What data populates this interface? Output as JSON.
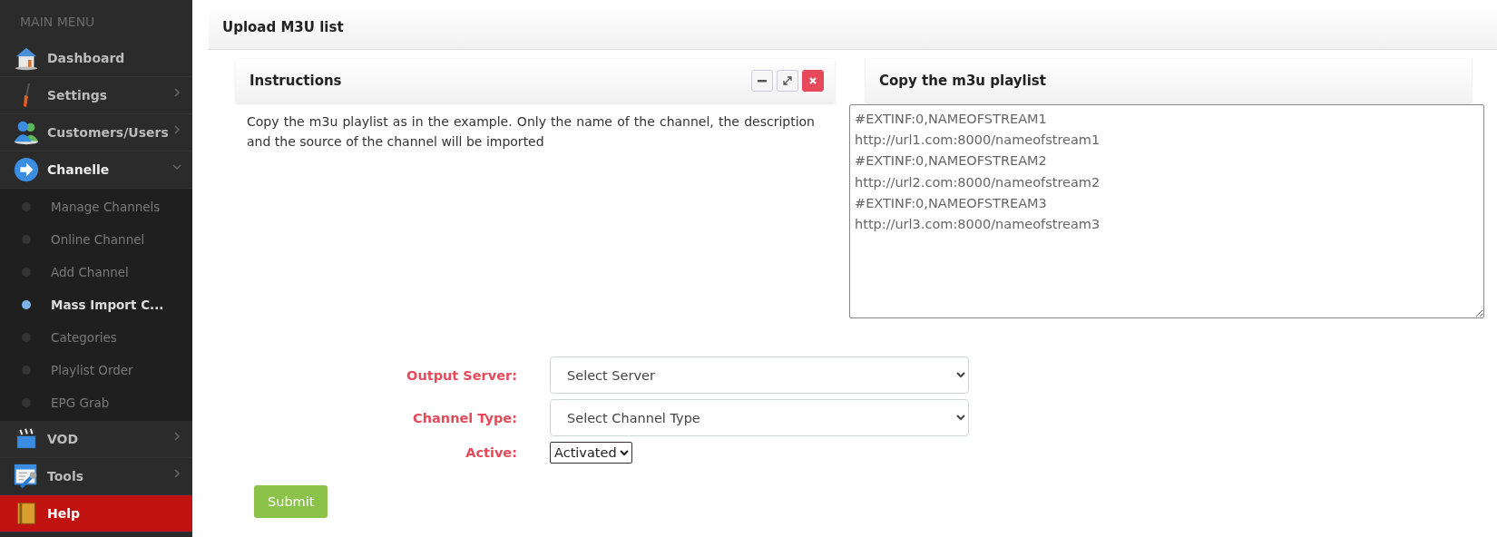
{
  "sidebar": {
    "heading": "MAIN MENU",
    "items": [
      {
        "label": "Dashboard",
        "kind": "link",
        "expanded": false,
        "highlighted": false
      },
      {
        "label": "Settings",
        "kind": "menu",
        "expanded": false,
        "highlighted": false
      },
      {
        "label": "Customers/Users",
        "kind": "menu",
        "expanded": false,
        "highlighted": false
      },
      {
        "label": "Chanelle",
        "kind": "menu",
        "expanded": true,
        "highlighted": false,
        "children": [
          {
            "label": "Manage Channels",
            "selected": false
          },
          {
            "label": "Online Channel",
            "selected": false
          },
          {
            "label": "Add Channel",
            "selected": false
          },
          {
            "label": "Mass Import C...",
            "selected": true
          },
          {
            "label": "Categories",
            "selected": false
          },
          {
            "label": "Playlist Order",
            "selected": false
          },
          {
            "label": "EPG Grab",
            "selected": false
          }
        ]
      },
      {
        "label": "VOD",
        "kind": "menu",
        "expanded": false,
        "highlighted": false
      },
      {
        "label": "Tools",
        "kind": "menu",
        "expanded": false,
        "highlighted": false
      },
      {
        "label": "Help",
        "kind": "link",
        "expanded": false,
        "highlighted": true
      }
    ]
  },
  "page": {
    "title": "Upload M3U list"
  },
  "instructions": {
    "title": "Instructions",
    "text": "Copy the m3u playlist as in the example. Only the name of the channel, the description and the source of the channel will be imported"
  },
  "playlist": {
    "title": "Copy the m3u playlist",
    "value": "#EXTINF:0,NAMEOFSTREAM1\nhttp://url1.com:8000/nameofstream1\n#EXTINF:0,NAMEOFSTREAM2\nhttp://url2.com:8000/nameofstream2\n#EXTINF:0,NAMEOFSTREAM3\nhttp://url3.com:8000/nameofstream3"
  },
  "form": {
    "fields": [
      {
        "label": "Output Server:",
        "kind": "wide",
        "value": "Select Server"
      },
      {
        "label": "Channel Type:",
        "kind": "wide",
        "value": "Select Channel Type"
      },
      {
        "label": "Active:",
        "kind": "compact",
        "value": "Activated"
      }
    ],
    "submit": "Submit"
  }
}
